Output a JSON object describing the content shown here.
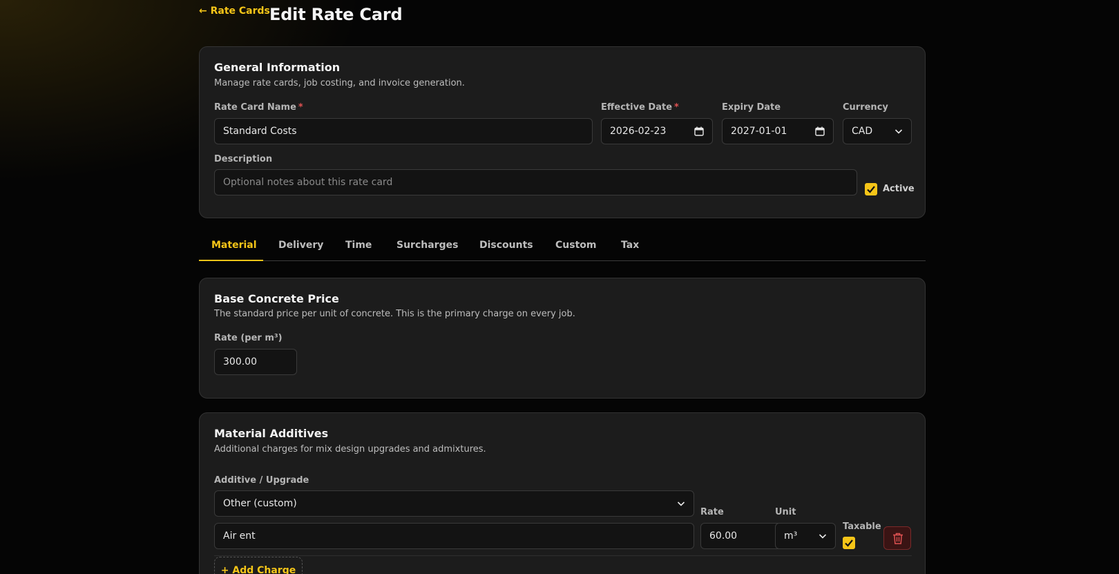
{
  "header": {
    "back_label": "← Rate Cards",
    "title": "Edit Rate Card"
  },
  "general": {
    "title": "General Information",
    "subtitle": "Manage rate cards, job costing, and invoice generation.",
    "name_label": "Rate Card Name",
    "name_value": "Standard Costs",
    "effective_label": "Effective Date",
    "effective_value": "2026-02-23",
    "expiry_label": "Expiry Date",
    "expiry_value": "2027-01-01",
    "currency_label": "Currency",
    "currency_value": "CAD",
    "description_label": "Description",
    "description_placeholder": "Optional notes about this rate card",
    "active_label": "Active",
    "active_checked": true,
    "required_mark": "*"
  },
  "tabs": [
    {
      "label": "Material",
      "active": true
    },
    {
      "label": "Delivery"
    },
    {
      "label": "Time"
    },
    {
      "label": "Surcharges"
    },
    {
      "label": "Discounts"
    },
    {
      "label": "Custom"
    },
    {
      "label": "Tax"
    }
  ],
  "base_price": {
    "title": "Base Concrete Price",
    "subtitle": "The standard price per unit of concrete. This is the primary charge on every job.",
    "rate_label": "Rate (per m³)",
    "rate_value": "300.00"
  },
  "additives": {
    "title": "Material Additives",
    "subtitle": "Additional charges for mix design upgrades and admixtures.",
    "additive_label": "Additive / Upgrade",
    "additive_value": "Other (custom)",
    "custom_name_value": "Air ent",
    "rate_label": "Rate",
    "rate_value": "60.00",
    "unit_label": "Unit",
    "unit_value": "m³",
    "taxable_label": "Taxable",
    "taxable_checked": true,
    "add_label": "+ Add Charge"
  },
  "colors": {
    "accent": "#f5c518",
    "danger": "#e05252",
    "background": "#050505",
    "card": "#1c1c1c"
  }
}
